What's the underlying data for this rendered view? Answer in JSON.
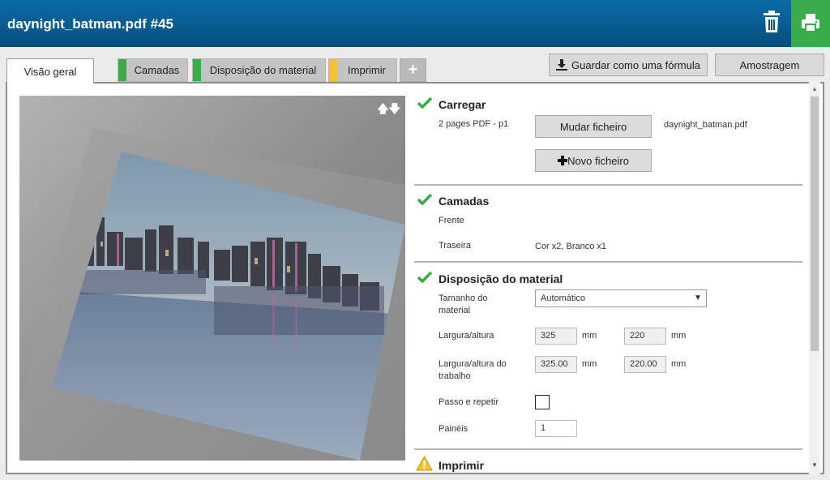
{
  "header": {
    "title": "daynight_batman.pdf #45",
    "trash_icon": "trash-icon",
    "print_icon": "printer-icon",
    "accent": "#3aab4a"
  },
  "tabs": [
    {
      "label": "Visão geral",
      "stripe": ""
    },
    {
      "label": "Camadas",
      "stripe": "#3aab4a"
    },
    {
      "label": "Disposição do material",
      "stripe": "#3aab4a"
    },
    {
      "label": "Imprimir",
      "stripe": "#f0c330"
    }
  ],
  "toolbar": {
    "add_tab_label": "+",
    "save_formula_label": "Guardar como uma fórmula",
    "sampling_label": "Amostragem"
  },
  "preview": {
    "sort_arrows": "🡅🡇"
  },
  "load": {
    "title": "Carregar",
    "pages_info": "2 pages PDF - p1",
    "change_file_label": "Mudar ficheiro",
    "file_name": "daynight_batman.pdf",
    "new_file_label": "Novo ficheiro"
  },
  "layers": {
    "title": "Camadas",
    "front_label": "Frente",
    "back_label": "Traseira",
    "back_value": "Cor x2, Branco x1"
  },
  "media": {
    "title": "Disposição do material",
    "size_label": "Tamanho do material",
    "size_value": "Automático",
    "wh_label": "Largura/altura",
    "width": "325",
    "height": "220",
    "unit": "mm",
    "job_wh_label": "Largura/altura do trabalho",
    "job_width": "325.00",
    "job_height": "220.00",
    "step_repeat_label": "Passo e repetir",
    "panels_label": "Painéis",
    "panels_value": "1"
  },
  "print": {
    "title": "Imprimir",
    "warning_icon": "warning-icon"
  }
}
